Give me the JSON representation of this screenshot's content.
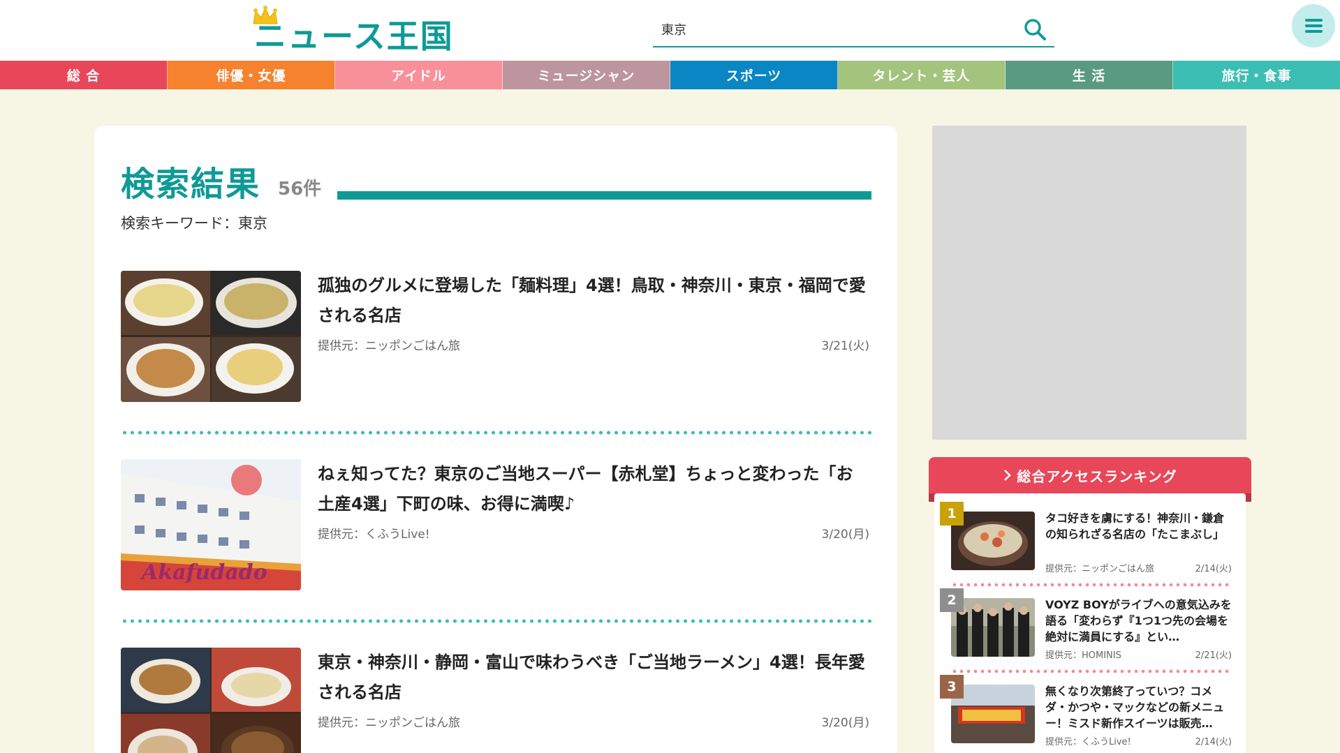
{
  "header": {
    "logo_text": "ニュース王国",
    "search": {
      "value": "東京",
      "placeholder": ""
    }
  },
  "nav": [
    {
      "label": "総 合",
      "color": "#e8475a"
    },
    {
      "label": "俳優・女優",
      "color": "#f6822d"
    },
    {
      "label": "アイドル",
      "color": "#f8909a"
    },
    {
      "label": "ミュージシャン",
      "color": "#bd959e"
    },
    {
      "label": "スポーツ",
      "color": "#0a86c4"
    },
    {
      "label": "タレント・芸人",
      "color": "#a2c47c"
    },
    {
      "label": "生 活",
      "color": "#5a9a82"
    },
    {
      "label": "旅行・食事",
      "color": "#3bbfb5"
    }
  ],
  "results": {
    "title": "検索結果",
    "count": "56件",
    "keyword_line": "検索キーワード：東京"
  },
  "articles": [
    {
      "title": "孤独のグルメに登場した「麺料理」4選！鳥取・神奈川・東京・福岡で愛される名店",
      "source": "提供元：ニッポンごはん旅",
      "date": "3/21(火)"
    },
    {
      "title": "ねぇ知ってた？東京のご当地スーパー【赤札堂】ちょっと変わった「お土産4選」下町の味、お得に満喫♪",
      "source": "提供元：くふうLive!",
      "date": "3/20(月)"
    },
    {
      "title": "東京・神奈川・静岡・富山で味わうべき「ご当地ラーメン」4選！長年愛される名店",
      "source": "提供元：ニッポンごはん旅",
      "date": "3/20(月)"
    }
  ],
  "ranking": {
    "heading": "総合アクセスランキング",
    "items": [
      {
        "rank": "1",
        "badge_color": "#c9a20a",
        "title": "タコ好きを虜にする！神奈川・鎌倉の知られざる名店の「たこまぶし」",
        "source": "提供元：ニッポンごはん旅",
        "date": "2/14(火)"
      },
      {
        "rank": "2",
        "badge_color": "#8e8e8e",
        "title": "VOYZ BOYがライブへの意気込みを語る「変わらず『1つ1つ先の会場を絶対に満員にする』とい…",
        "source": "提供元：HOMINIS",
        "date": "2/21(火)"
      },
      {
        "rank": "3",
        "badge_color": "#9a6448",
        "title": "無くなり次第終了っていつ？コメダ・かつや・マックなどの新メニュー！ミスド新作スイーツは販売…",
        "source": "提供元：くふうLive!",
        "date": "2/14(火)"
      }
    ]
  },
  "colors": {
    "brand": "#0f9a96",
    "background": "#f7f6e4"
  }
}
